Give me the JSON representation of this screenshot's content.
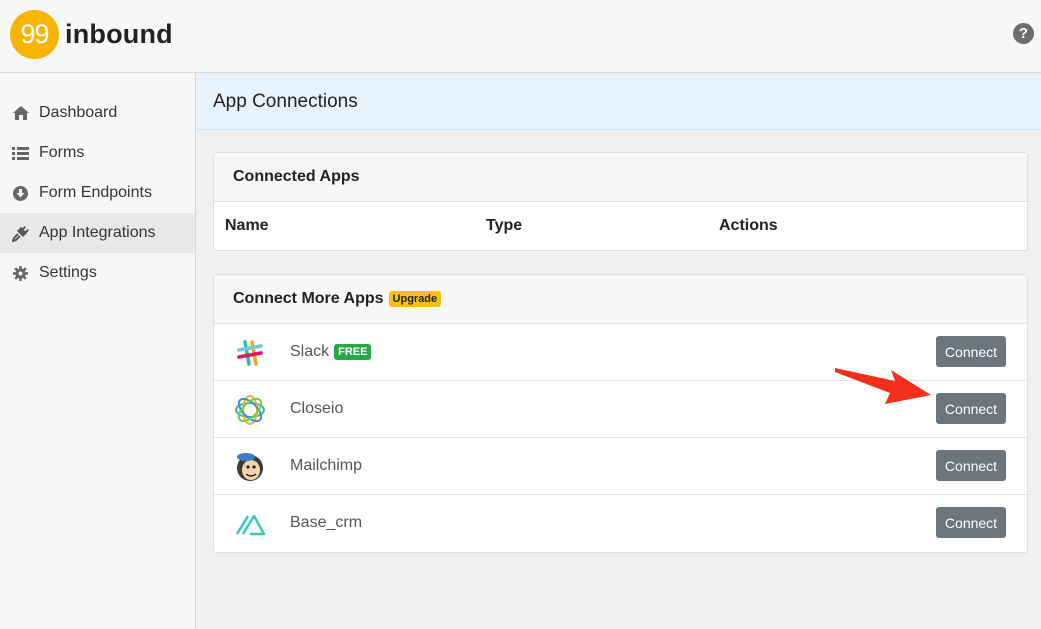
{
  "brand": {
    "logo_number": "99",
    "name": "inbound",
    "accent": "#f7b500"
  },
  "header": {
    "help_icon": "question-circle-icon",
    "help_label": "?"
  },
  "sidebar": {
    "items": [
      {
        "label": "Dashboard",
        "icon": "home-icon"
      },
      {
        "label": "Forms",
        "icon": "list-icon"
      },
      {
        "label": "Form Endpoints",
        "icon": "download-circle-icon"
      },
      {
        "label": "App Integrations",
        "icon": "plug-icon",
        "active": true
      },
      {
        "label": "Settings",
        "icon": "gear-icon"
      }
    ]
  },
  "page": {
    "title": "App Connections"
  },
  "connected_apps": {
    "title": "Connected Apps",
    "columns": [
      "Name",
      "Type",
      "Actions"
    ]
  },
  "more_apps": {
    "title": "Connect More Apps",
    "upgrade_badge": "Upgrade",
    "apps": [
      {
        "name": "Slack",
        "badge": "FREE",
        "button": "Connect",
        "icon": "slack-icon"
      },
      {
        "name": "Closeio",
        "button": "Connect",
        "icon": "closeio-icon"
      },
      {
        "name": "Mailchimp",
        "button": "Connect",
        "icon": "mailchimp-icon"
      },
      {
        "name": "Base_crm",
        "button": "Connect",
        "icon": "base-crm-icon"
      }
    ]
  },
  "colors": {
    "button": "#6c757d",
    "header_bg": "#e6f3fc",
    "free_badge": "#28a745",
    "upgrade_badge": "#f5c012",
    "annotation_arrow": "#f4301c"
  }
}
